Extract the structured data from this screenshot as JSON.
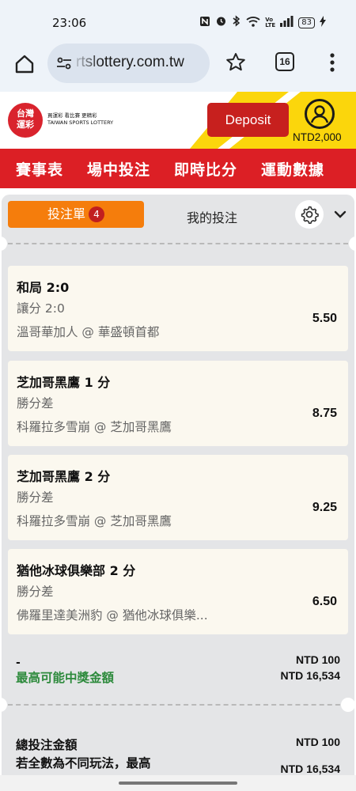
{
  "status_bar": {
    "time": "23:06",
    "icons": [
      "nfc-icon",
      "alarm-icon",
      "bluetooth-icon",
      "wifi-icon",
      "volte-icon",
      "signal-icon"
    ],
    "volte_text": "Vo LTE",
    "battery": "83"
  },
  "browser": {
    "url": "rtslottery.com.tw",
    "tab_count": "16"
  },
  "site_header": {
    "logo_text": "台灣運彩",
    "logo_tagline": "買運彩 看比賽 更精彩",
    "logo_english": "TAIWAN SPORTS LOTTERY",
    "deposit_label": "Deposit",
    "balance": "NTD2,000",
    "colors": {
      "red": "#c7201e",
      "yellow": "#fbd60c"
    }
  },
  "nav": {
    "items": [
      "賽事表",
      "場中投注",
      "即時比分",
      "運動數據"
    ]
  },
  "betslip": {
    "tab_label": "投注單",
    "count": "4",
    "my_bets_label": "我的投注",
    "accent_color": "#f57d0c",
    "bets": [
      {
        "selection": "和局 2:0",
        "market": "讓分 2:0",
        "match": "溫哥華加人 @ 華盛頓首都",
        "odds": "5.50"
      },
      {
        "selection": "芝加哥黑鷹 1 分",
        "market": "勝分差",
        "match": "科羅拉多雪崩 @ 芝加哥黑鷹",
        "odds": "8.75"
      },
      {
        "selection": "芝加哥黑鷹 2 分",
        "market": "勝分差",
        "match": "科羅拉多雪崩 @ 芝加哥黑鷹",
        "odds": "9.25"
      },
      {
        "selection": "猶他冰球俱樂部 2 分",
        "market": "勝分差",
        "match": "佛羅里達美洲豹 @ 猶他冰球俱樂...",
        "odds": "6.50"
      }
    ],
    "summary": {
      "dash": "-",
      "max_payout_label": "最高可能中獎金額",
      "stake": "NTD 100",
      "max_payout": "NTD 16,534"
    },
    "total": {
      "label": "總投注金額",
      "note": "若全數為不同玩法，最高",
      "stake": "NTD 100",
      "payout": "NTD 16,534"
    }
  }
}
